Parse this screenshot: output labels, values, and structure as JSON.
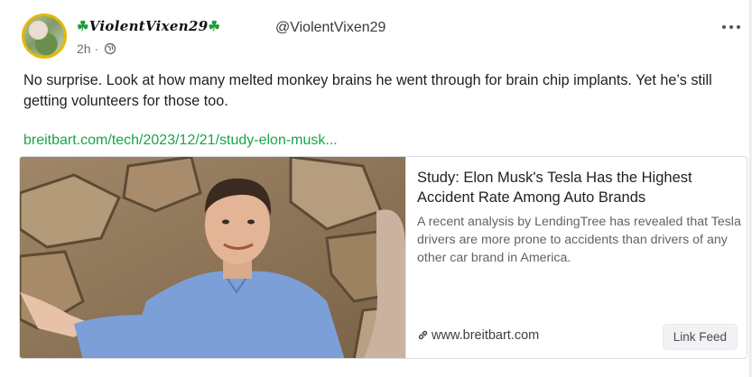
{
  "post": {
    "display_name": "ViolentVixen29",
    "display_decor": "☘",
    "handle": "@ViolentVixen29",
    "time": "2h",
    "separator": "·",
    "visibility_icon": "globe-icon",
    "text": "No surprise. Look at how many melted monkey brains he went through for brain chip implants. Yet he’s still getting volunteers for those too.",
    "link_text": "breitbart.com/tech/2023/12/21/study-elon-musk...",
    "more_icon": "more-horizontal-icon"
  },
  "preview": {
    "title": "Study: Elon Musk's Tesla Has the Highest Accident Rate Among Auto Brands",
    "description": "A recent analysis by LendingTree has revealed that Tesla drivers are more prone to accidents than drivers of any other car brand in America.",
    "domain": "www.breitbart.com",
    "link_icon": "link-icon",
    "button_label": "Link Feed"
  },
  "colors": {
    "link": "#1aa34a",
    "clover": "#1c9b3a",
    "avatar_ring": "#e8b700"
  }
}
